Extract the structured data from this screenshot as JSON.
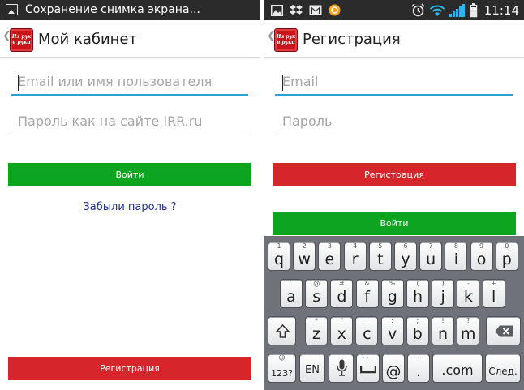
{
  "left": {
    "statusbar": {
      "title": "Сохранение снимка экрана..."
    },
    "actionbar": {
      "title": "Мой кабинет",
      "logo_line1": "Из рук",
      "logo_line2": "в руки"
    },
    "login_field": {
      "placeholder": "Email или имя пользователя"
    },
    "password_field": {
      "placeholder": "Пароль как на сайте IRR.ru"
    },
    "login_button": "Войти",
    "forgot_link": "Забыли пароль ?",
    "register_button": "Регистрация"
  },
  "right": {
    "statusbar": {
      "time": "11:14",
      "icons": [
        "image-icon",
        "dropbox-icon",
        "gmail-icon",
        "app-icon",
        "alarm-icon",
        "wifi-icon",
        "signal-icon",
        "battery-icon"
      ]
    },
    "actionbar": {
      "title": "Регистрация",
      "logo_line1": "Из рук",
      "logo_line2": "в руки"
    },
    "email_field": {
      "placeholder": "Email"
    },
    "password_field": {
      "placeholder": "Пароль"
    },
    "register_button": "Регистрация",
    "login_button": "Войти",
    "keyboard": {
      "row1": [
        {
          "k": "q",
          "h": "1"
        },
        {
          "k": "w",
          "h": "2"
        },
        {
          "k": "e",
          "h": "3"
        },
        {
          "k": "r",
          "h": "4"
        },
        {
          "k": "t",
          "h": "5"
        },
        {
          "k": "y",
          "h": "6"
        },
        {
          "k": "u",
          "h": "7"
        },
        {
          "k": "i",
          "h": "8"
        },
        {
          "k": "o",
          "h": "9"
        },
        {
          "k": "p",
          "h": "0"
        }
      ],
      "row2": [
        {
          "k": "a",
          "h": "`"
        },
        {
          "k": "s",
          "h": "@"
        },
        {
          "k": "d",
          "h": "#"
        },
        {
          "k": "f",
          "h": "&"
        },
        {
          "k": "g",
          "h": "%"
        },
        {
          "k": "h",
          "h": "("
        },
        {
          "k": "j",
          "h": ")"
        },
        {
          "k": "k",
          "h": "-"
        },
        {
          "k": "l",
          "h": "+"
        }
      ],
      "row3": [
        {
          "k": "z",
          "h": "*"
        },
        {
          "k": "x",
          "h": "\""
        },
        {
          "k": "c",
          "h": "'"
        },
        {
          "k": "v",
          "h": ":"
        },
        {
          "k": "b",
          "h": ";"
        },
        {
          "k": "n",
          "h": "!"
        },
        {
          "k": "m",
          "h": "?"
        }
      ],
      "symbols_key": "123?",
      "symbols_hint": "☺",
      "lang_key": "EN",
      "at_key": "@",
      "dot_key": ".",
      "com_key": ".com",
      "next_key": "След."
    }
  },
  "colors": {
    "green": "#0da51f",
    "red": "#d7262b",
    "focus": "#2aa1d3",
    "link": "#1f2f8f"
  }
}
